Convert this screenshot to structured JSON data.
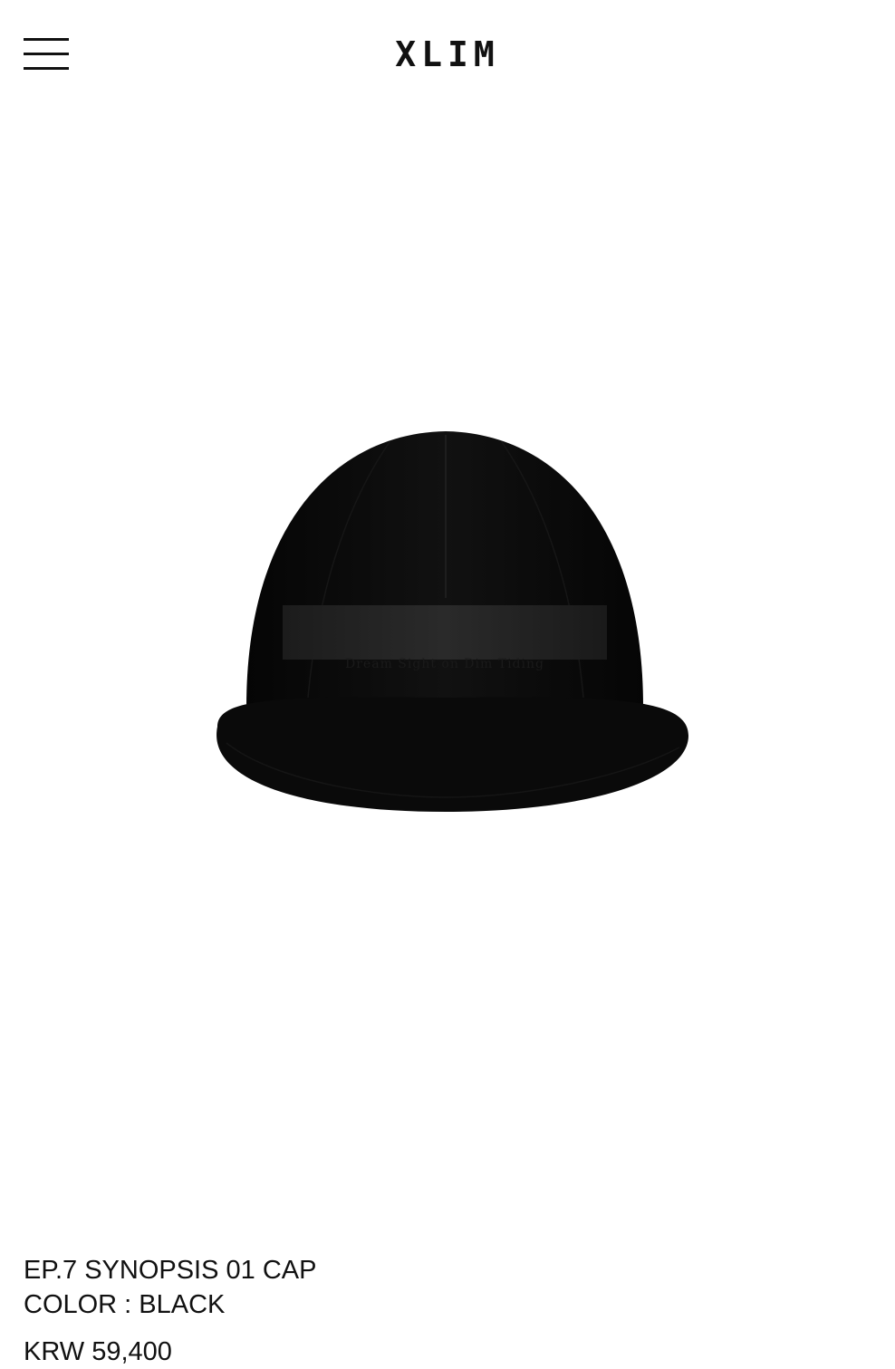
{
  "header": {
    "menu_icon": "hamburger-menu-icon",
    "logo_text": "XLIM"
  },
  "product": {
    "image_description_icon": "black-cap-image",
    "name": "EP.7 SYNOPSIS 01 CAP",
    "color_label": "COLOR : BLACK",
    "price": "KRW 59,400"
  },
  "colors": {
    "background": "#ffffff",
    "text": "#111111",
    "cap": "#0b0b0b"
  }
}
